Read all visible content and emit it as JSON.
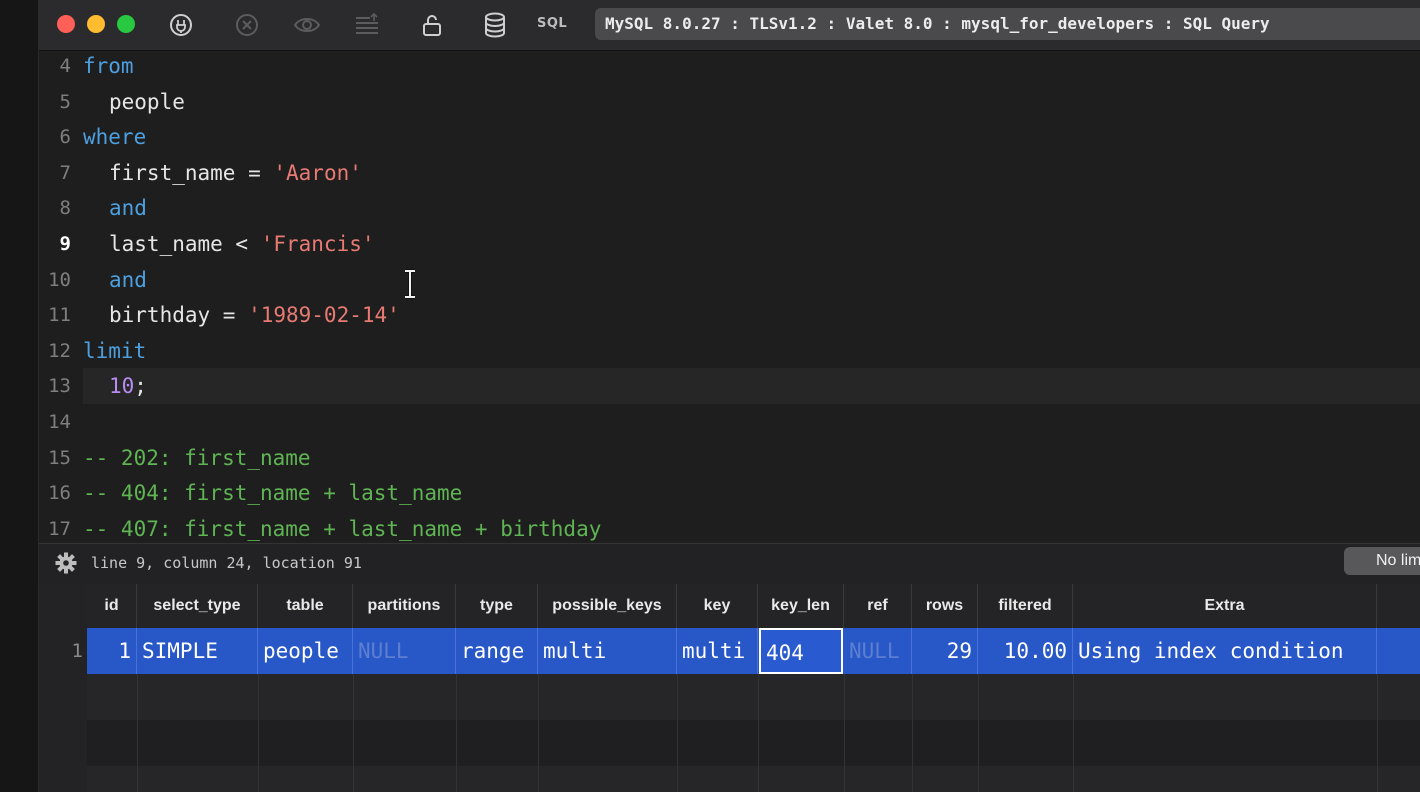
{
  "toolbar": {
    "sql_label": "SQL",
    "connection": "MySQL 8.0.27 : TLSv1.2 : Valet 8.0 : mysql_for_developers : SQL Query"
  },
  "editor": {
    "active_line": 9,
    "lines": [
      {
        "n": "4",
        "parts": [
          {
            "t": "from",
            "c": "kw"
          }
        ]
      },
      {
        "n": "5",
        "parts": [
          {
            "t": "people",
            "c": "id"
          }
        ]
      },
      {
        "n": "6",
        "parts": [
          {
            "t": "where",
            "c": "kw"
          }
        ]
      },
      {
        "n": "7",
        "parts": [
          {
            "t": "first_name = ",
            "c": "id"
          },
          {
            "t": "'Aaron'",
            "c": "str"
          }
        ]
      },
      {
        "n": "8",
        "parts": [
          {
            "t": "and",
            "c": "kw"
          }
        ]
      },
      {
        "n": "9",
        "parts": [
          {
            "t": "last_name < ",
            "c": "id"
          },
          {
            "t": "'Francis'",
            "c": "str"
          }
        ]
      },
      {
        "n": "10",
        "parts": [
          {
            "t": "and",
            "c": "kw"
          }
        ]
      },
      {
        "n": "11",
        "parts": [
          {
            "t": "birthday = ",
            "c": "id"
          },
          {
            "t": "'1989-02-14'",
            "c": "str"
          }
        ]
      },
      {
        "n": "12",
        "parts": [
          {
            "t": "limit",
            "c": "kw"
          }
        ]
      },
      {
        "n": "13",
        "parts": [
          {
            "t": "10",
            "c": "num"
          },
          {
            "t": ";",
            "c": "id"
          }
        ]
      },
      {
        "n": "14",
        "parts": []
      },
      {
        "n": "15",
        "parts": [
          {
            "t": "-- 202: first_name",
            "c": "cmt"
          }
        ]
      },
      {
        "n": "16",
        "parts": [
          {
            "t": "-- 404: first_name + last_name",
            "c": "cmt"
          }
        ]
      },
      {
        "n": "17",
        "parts": [
          {
            "t": "-- 407: first_name + last_name + birthday",
            "c": "cmt"
          }
        ]
      }
    ]
  },
  "status": {
    "position": "line 9, column 24, location 91",
    "limit_button": "No limit"
  },
  "results": {
    "columns": [
      "id",
      "select_type",
      "table",
      "partitions",
      "type",
      "possible_keys",
      "key",
      "key_len",
      "ref",
      "rows",
      "filtered",
      "Extra"
    ],
    "rows": [
      {
        "row_number": "1",
        "cells": [
          "1",
          "SIMPLE",
          "people",
          "NULL",
          "range",
          "multi",
          "multi",
          "404",
          "NULL",
          "29",
          "10.00",
          "Using index condition"
        ]
      }
    ]
  },
  "colors": {
    "keyword": "#4d9fe0",
    "string": "#e87a74",
    "number": "#b78cf2",
    "comment": "#5fb453",
    "selection": "#2857c8"
  },
  "icons": [
    "power-icon",
    "stop-icon",
    "eye-icon",
    "format-icon",
    "lock-icon",
    "database-icon",
    "gear-icon",
    "text-cursor-icon"
  ]
}
